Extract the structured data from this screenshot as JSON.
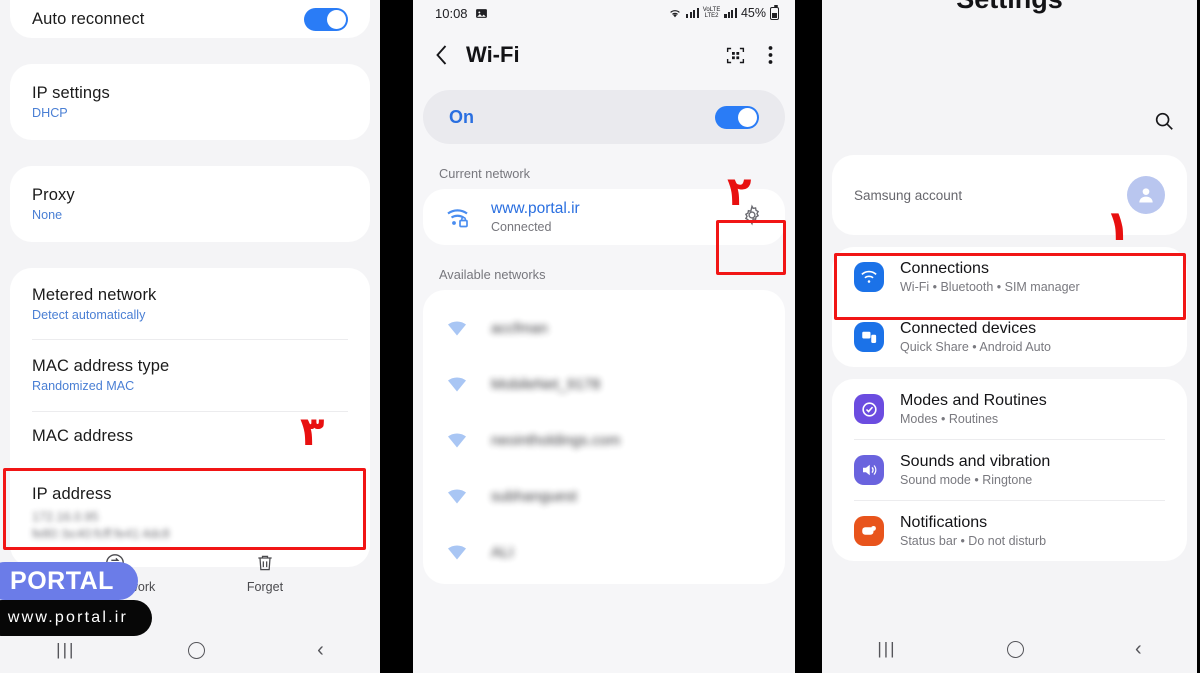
{
  "left_panel": {
    "auto_reconnect": {
      "label": "Auto reconnect",
      "toggle_state": "on"
    },
    "items": [
      {
        "title": "IP settings",
        "value": "DHCP"
      },
      {
        "title": "Proxy",
        "value": "None"
      },
      {
        "title": "Metered network",
        "value": "Detect automatically"
      },
      {
        "title": "MAC address type",
        "value": "Randomized MAC"
      },
      {
        "title": "MAC address",
        "value": ""
      }
    ],
    "ip_address": {
      "title": "IP address",
      "value_v4": "172.16.0.95",
      "value_v6": "fe80::bc40:fcff:fe41:4dc8",
      "blurred": true
    },
    "actions": [
      {
        "label": "Share network",
        "icon": "share-network-icon"
      },
      {
        "label": "Forget",
        "icon": "trash-icon"
      }
    ],
    "marker": "۳"
  },
  "middle_panel": {
    "status_bar": {
      "time": "10:08",
      "image_icon": "screenshot-icon",
      "battery": "45%",
      "network": "LTE2",
      "volte": "VoLTE"
    },
    "header": {
      "title": "Wi-Fi",
      "back_icon": "back-chevron-icon",
      "qr_icon": "qr-scan-icon",
      "more_icon": "kebab-menu-icon"
    },
    "power": {
      "label": "On",
      "toggle_state": "on"
    },
    "current_network_label": "Current network",
    "current_network": {
      "ssid": "www.portal.ir",
      "status": "Connected",
      "gear_icon": "gear-icon"
    },
    "available_networks_label": "Available networks",
    "available_networks": [
      {
        "ssid": "accfman",
        "blurred": true
      },
      {
        "ssid": "MobileNet_9178",
        "blurred": true
      },
      {
        "ssid": "neointholdings.com",
        "blurred": true
      },
      {
        "ssid": "subhanguest",
        "blurred": true
      },
      {
        "ssid": "ALI",
        "blurred": true
      }
    ],
    "marker": "۲"
  },
  "right_panel": {
    "title": "Settings",
    "search_icon": "search-icon",
    "account": {
      "label": "Samsung account",
      "avatar_icon": "person-avatar-icon"
    },
    "groups": [
      {
        "items": [
          {
            "title": "Connections",
            "sub": "Wi-Fi • Bluetooth • SIM manager",
            "icon": "wifi-icon",
            "color": "#1b72e8"
          },
          {
            "title": "Connected devices",
            "sub": "Quick Share • Android Auto",
            "icon": "devices-icon",
            "color": "#1b72e8"
          }
        ]
      },
      {
        "items": [
          {
            "title": "Modes and Routines",
            "sub": "Modes • Routines",
            "icon": "modes-check-icon",
            "color": "#6b4ce0"
          },
          {
            "title": "Sounds and vibration",
            "sub": "Sound mode • Ringtone",
            "icon": "speaker-icon",
            "color": "#6a63de"
          },
          {
            "title": "Notifications",
            "sub": "Status bar • Do not disturb",
            "icon": "notification-icon",
            "color": "#e8541c"
          }
        ]
      }
    ],
    "marker": "۱"
  },
  "navbar": {
    "recent_icon": "recents-icon",
    "home_icon": "home-icon",
    "back_icon": "back-icon"
  },
  "watermark": {
    "brand": "PORTAL",
    "url": "www.portal.ir"
  },
  "colors": {
    "accent_blue": "#2a7cf6",
    "highlight_red": "#f11515",
    "link_blue": "#4a7fd4"
  }
}
